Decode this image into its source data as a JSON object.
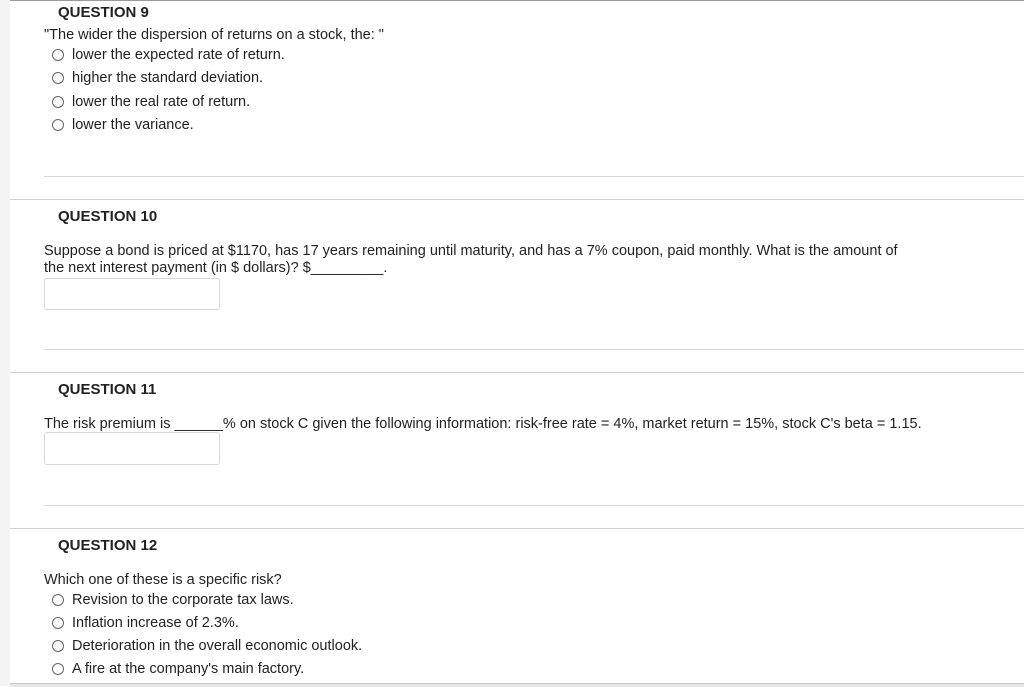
{
  "questions": [
    {
      "heading": "QUESTION 9",
      "text": "\"The wider the dispersion of returns on a stock, the: \"",
      "options": [
        "lower the expected rate of return.",
        "higher the standard deviation.",
        "lower the real rate of return.",
        "lower the variance."
      ]
    },
    {
      "heading": "QUESTION 10",
      "line1": "Suppose a bond is priced at $1170, has 17 years remaining until maturity, and has a 7% coupon, paid monthly. What is the amount of",
      "line2": "the next interest payment (in $ dollars)? $",
      "blank": "_________",
      "after": ".",
      "answer": ""
    },
    {
      "heading": "QUESTION 11",
      "before": "The risk premium is ",
      "blank": "______",
      "after": "% on stock C given the following information: risk-free rate = 4%, market return = 15%, stock C's beta = 1.15.",
      "answer": ""
    },
    {
      "heading": "QUESTION 12",
      "text": "Which one of these is a specific risk?",
      "options": [
        "Revision to the corporate tax laws.",
        "Inflation increase of 2.3%.",
        "Deterioration in the overall economic outlook.",
        "A fire at the company's main factory."
      ]
    }
  ]
}
